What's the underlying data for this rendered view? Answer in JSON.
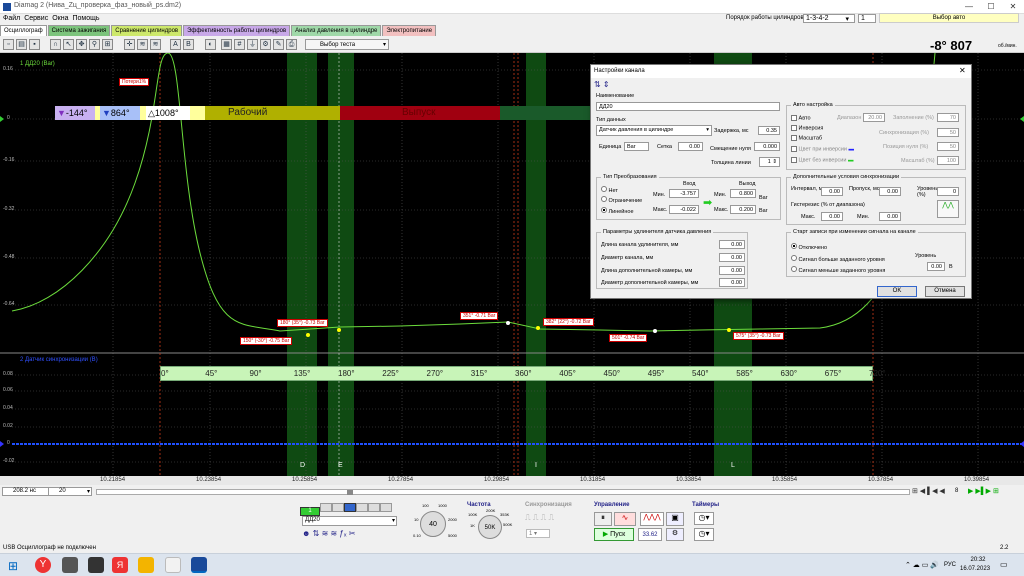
{
  "title": "Diamag 2 (Нива_Zц_проверка_фаз_новый_ps.dm2)",
  "menu": [
    "Файл",
    "Сервис",
    "Окна",
    "Помощь"
  ],
  "cyl_order_label": "Порядок работы цилиндров",
  "cyl_order_value": "1-3-4-2",
  "cyl_num": "1",
  "auto_select": "Выбор авто",
  "tabs": [
    {
      "label": "Осциллограф",
      "color": "#ffffff"
    },
    {
      "label": "Система зажигания",
      "color": "#7cc47c"
    },
    {
      "label": "Сравнение цилиндров",
      "color": "#cde86b"
    },
    {
      "label": "Эффективность работы цилиндров",
      "color": "#c8a8e8"
    },
    {
      "label": "Анализ давления в цилиндре",
      "color": "#9fd8a8"
    },
    {
      "label": "Электропитание",
      "color": "#f2c0c0"
    }
  ],
  "test_select": "Выбор теста",
  "readout": {
    "value": "-8° 807",
    "unit": "об./мин."
  },
  "ch1": {
    "label": "1 ДД20 (Bar)",
    "ticks": [
      "0.16",
      "0",
      "-0.16",
      "-0.32",
      "-0.48",
      "-0.64"
    ]
  },
  "ch2": {
    "label": "2 Датчик синхронизации (В)",
    "ticks": [
      "0.08",
      "0.06",
      "0.04",
      "0.02",
      "0",
      "-0.02"
    ]
  },
  "phase_bar": {
    "a": "-144°",
    "b": "864°",
    "c": "1008°",
    "work": "Рабочий",
    "exhaust": "Выпуск"
  },
  "loss_marker": "Потери1%",
  "markers": [
    "180° (35°) -0.73 Bar",
    "150° (-30°) -0.75 Bar",
    "351° -0.71 Bar",
    "382° (22°) -0.72 Bar",
    "501° -0.74 Bar",
    "575° (35°) -0.73 Bar"
  ],
  "degrees": [
    "0°",
    "45°",
    "90°",
    "135°",
    "180°",
    "225°",
    "270°",
    "315°",
    "360°",
    "405°",
    "450°",
    "495°",
    "540°",
    "585°",
    "630°",
    "675°",
    "720°"
  ],
  "zones": [
    "D",
    "E",
    "I",
    "L"
  ],
  "time_ticks": [
    "10.21854",
    "10.23854",
    "10.25854",
    "10.27854",
    "10.29854",
    "10.31854",
    "10.33854",
    "10.35854",
    "10.37854",
    "10.39854"
  ],
  "dialog": {
    "title": "Настройки канала",
    "name_label": "Наименование",
    "name_value": "ДД20",
    "dtype_label": "Тип данных",
    "dtype_value": "Датчик давления в цилиндре",
    "delay_label": "Задержка, мс",
    "delay_value": "0.35",
    "unit_label": "Единица",
    "unit_value": "Bar",
    "grid_label": "Сетка",
    "grid_value": "0.00",
    "zero_label": "Смещение нуля",
    "zero_value": "0.000",
    "line_label": "Толщина линии",
    "line_value": "1",
    "conv_title": "Тип Преобразования",
    "conv_opts": [
      "Нет",
      "Ограничение",
      "Линейное"
    ],
    "in_label": "Вход",
    "out_label": "Выход",
    "min_label": "Мин.",
    "max_label": "Макс.",
    "in_min": "-3.757",
    "in_max": "-0.022",
    "out_min": "0.800",
    "out_max": "0.200",
    "out_unit": "Bar",
    "ext_title": "Параметры удлинителя датчика давления",
    "ext_rows": [
      {
        "l": "Длина канала удлинителя, мм",
        "v": "0.00"
      },
      {
        "l": "Диаметр канала, мм",
        "v": "0.00"
      },
      {
        "l": "Длина дополнительной камеры, мм",
        "v": "0.00"
      },
      {
        "l": "Диаметр дополнительной камеры, мм",
        "v": "0.00"
      }
    ],
    "auto_title": "Авто настройка",
    "auto_rows": [
      {
        "c": "Авто",
        "l": "Диапазон",
        "v": "20.00"
      },
      {
        "c": "Инверсия",
        "l": "Синхронизация (%)",
        "v": "50"
      },
      {
        "c": "Масштаб",
        "l": "Позиция нуля (%)",
        "v": "50"
      },
      {
        "c": "Цвет при инверсии",
        "l": "Масштаб (%)",
        "v": "100"
      },
      {
        "c": "Цвет без инверсии",
        "l": "",
        "v": ""
      }
    ],
    "fill_label": "Заполнение (%)",
    "fill_value": "70",
    "sync_title": "Дополнительные условия синхронизации",
    "interval_label": "Интервал, мс",
    "interval_value": "0.00",
    "skip_label": "Пропуск, мс",
    "skip_value": "0.00",
    "level_label": "Уровень (%)",
    "level_value": "0",
    "hyst_label": "Гистерезис (% от диапазона)",
    "hmax_label": "Макс.",
    "hmax_value": "0.00",
    "hmin_label": "Мин.",
    "hmin_value": "0.00",
    "start_title": "Старт записи при изменении сигнала на канале",
    "start_opts": [
      "Отключено",
      "Сигнал больше заданного уровня",
      "Сигнал меньше заданного уровня"
    ],
    "start_level_label": "Уровень",
    "start_level_value": "0.00",
    "start_level_unit": "В",
    "ok": "OK",
    "cancel": "Отмена"
  },
  "bottom": {
    "time_div": "208.2 нс",
    "ch_sel": "20",
    "page": "8",
    "channel": "ДД20",
    "freq_title": "Частота",
    "sync_title": "Синхронизация",
    "ctrl_title": "Управление",
    "timers_title": "Таймеры",
    "start_btn": "Пуск",
    "counter": "33.62",
    "knob1": "40",
    "knob2": "50K",
    "k1": [
      "100",
      "1000",
      "2000",
      "5000",
      "10",
      "0.10"
    ],
    "k2": [
      "100K",
      "200K",
      "353K",
      "500K",
      "1K"
    ],
    "sync_value": "1"
  },
  "status": "USB Осциллограф не подключен",
  "ver": "2.2",
  "tray": {
    "lang": "РУС",
    "time": "20:32",
    "date": "16.07.2023"
  }
}
